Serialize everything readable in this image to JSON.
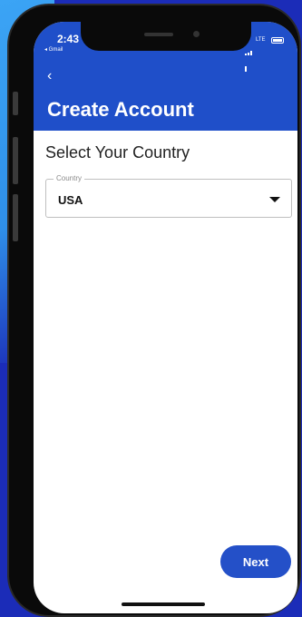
{
  "status_bar": {
    "time": "2:43",
    "back_app": "◂ Gmail",
    "network": "LTE"
  },
  "header": {
    "back_icon": "chevron-left-icon",
    "title": "Create Account",
    "color": "#1f4fc9"
  },
  "country_section": {
    "label": "Select Your Country",
    "field_label": "Country",
    "selected_value": "USA"
  },
  "actions": {
    "next_label": "Next",
    "accent": "#2450c8"
  }
}
